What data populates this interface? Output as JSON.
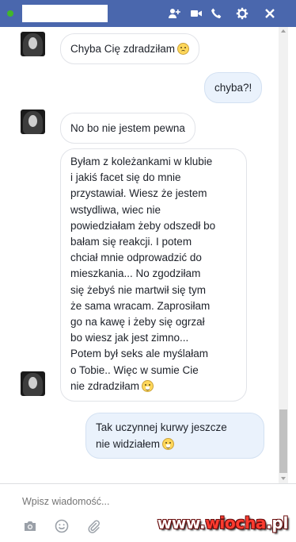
{
  "header": {
    "contact_name": "",
    "online": true,
    "icons": [
      "add-person-icon",
      "video-camera-icon",
      "phone-icon",
      "gear-icon",
      "close-icon"
    ]
  },
  "messages": [
    {
      "from": "them",
      "text": "Chyba Cię zdradziłam",
      "emoji": "confused-face"
    },
    {
      "from": "me",
      "text": "chyba?!"
    },
    {
      "from": "them",
      "text": "No bo nie jestem pewna"
    },
    {
      "from": "them",
      "text": "Byłam z koleżankami w klubie\ni jakiś facet się do mnie\nprzystawiał. Wiesz że jestem\nwstydliwa, wiec nie\npowiedziałam żeby odszedł bo\nbałam się reakcji. I potem\nchciał mnie odprowadzić do\nmieszkania... No zgodziłam\nsię żebyś nie martwił się tym\nże sama wracam. Zaprosiłam\ngo na kawę i żeby się ogrzał\nbo wiesz jak jest zimno...\nPotem był seks ale myślałam\no Tobie.. Więc w sumie Cie\nnie zdradziłam",
      "emoji": "grinning-face"
    },
    {
      "from": "me",
      "text": "Tak uczynnej kurwy jeszcze\nnie widziałem",
      "emoji": "grinning-face"
    }
  ],
  "compose": {
    "placeholder": "Wpisz wiadomość...",
    "tools": [
      "camera-icon",
      "emoji-icon",
      "attach-icon"
    ]
  },
  "watermark": {
    "prefix": "www.",
    "brand": "wiocha",
    "suffix": ".pl"
  },
  "colors": {
    "header_bg": "#4a67ad",
    "online": "#42b72a",
    "outgoing_bubble": "#eaf2fc",
    "incoming_bubble": "#ffffff"
  }
}
